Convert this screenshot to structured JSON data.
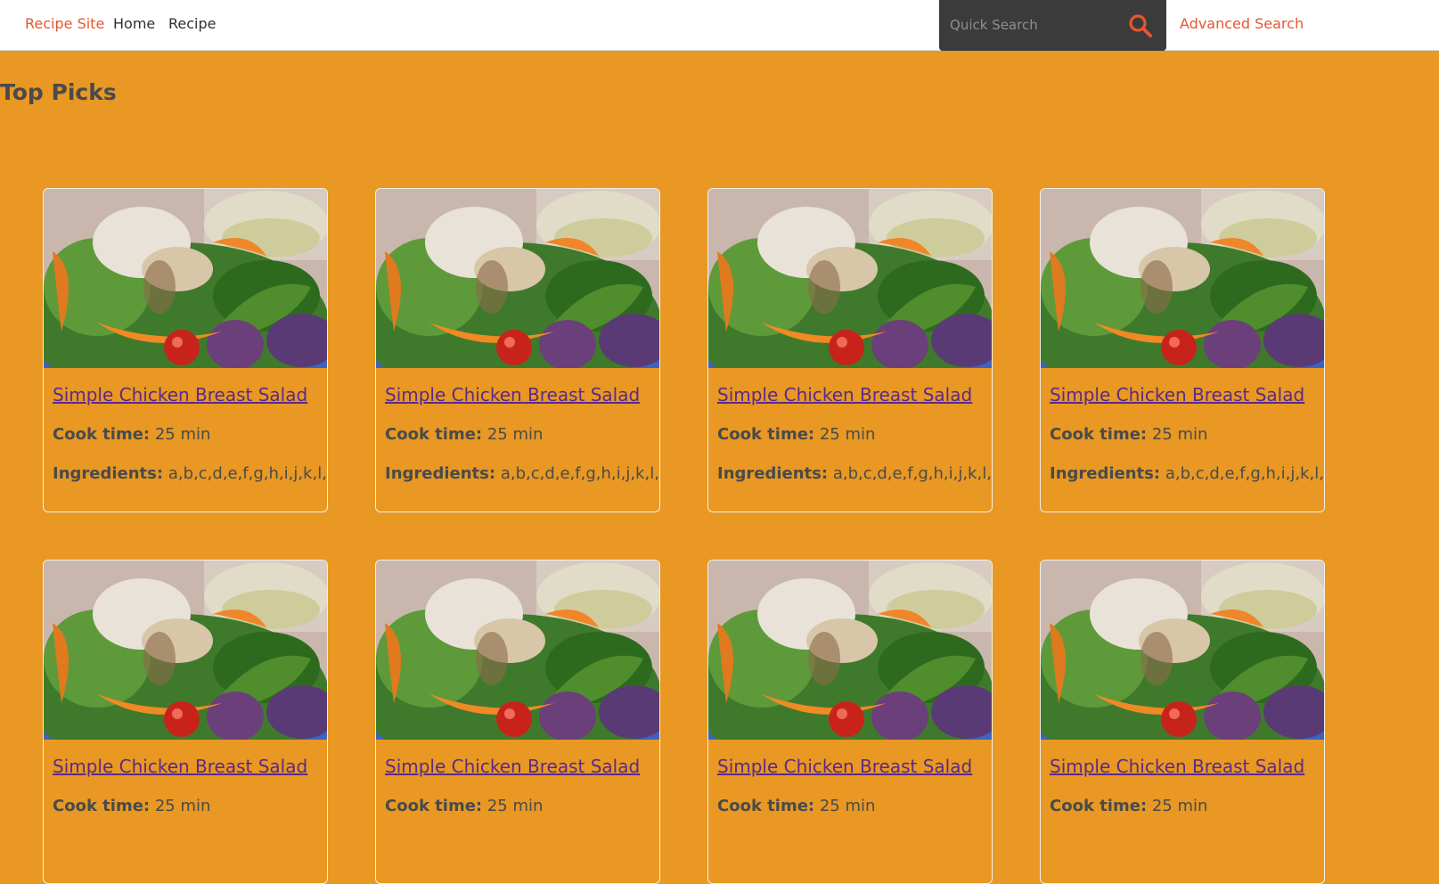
{
  "nav": {
    "brand": "Recipe Site",
    "home": "Home",
    "recipe": "Recipe",
    "search_placeholder": "Quick Search",
    "advanced_search": "Advanced Search",
    "search_icon": "search-icon"
  },
  "main": {
    "section_title": "Top Picks",
    "cards": [
      {
        "title": "Simple Chicken Breast Salad",
        "cook_label": "Cook time:",
        "cook_value": "25 min",
        "ing_label": "Ingredients:",
        "ing_value": "a,b,c,d,e,f,g,h,i,j,k,l,m"
      },
      {
        "title": "Simple Chicken Breast Salad",
        "cook_label": "Cook time:",
        "cook_value": "25 min",
        "ing_label": "Ingredients:",
        "ing_value": "a,b,c,d,e,f,g,h,i,j,k,l,m"
      },
      {
        "title": "Simple Chicken Breast Salad",
        "cook_label": "Cook time:",
        "cook_value": "25 min",
        "ing_label": "Ingredients:",
        "ing_value": "a,b,c,d,e,f,g,h,i,j,k,l,m"
      },
      {
        "title": "Simple Chicken Breast Salad",
        "cook_label": "Cook time:",
        "cook_value": "25 min",
        "ing_label": "Ingredients:",
        "ing_value": "a,b,c,d,e,f,g,h,i,j,k,l,m"
      },
      {
        "title": "Simple Chicken Breast Salad",
        "cook_label": "Cook time:",
        "cook_value": "25 min"
      },
      {
        "title": "Simple Chicken Breast Salad",
        "cook_label": "Cook time:",
        "cook_value": "25 min"
      },
      {
        "title": "Simple Chicken Breast Salad",
        "cook_label": "Cook time:",
        "cook_value": "25 min"
      },
      {
        "title": "Simple Chicken Breast Salad",
        "cook_label": "Cook time:",
        "cook_value": "25 min"
      }
    ]
  },
  "colors": {
    "background": "#e89823",
    "accent": "#e8552f",
    "search_bg": "#3b3b3b",
    "link": "#5b2a86"
  }
}
